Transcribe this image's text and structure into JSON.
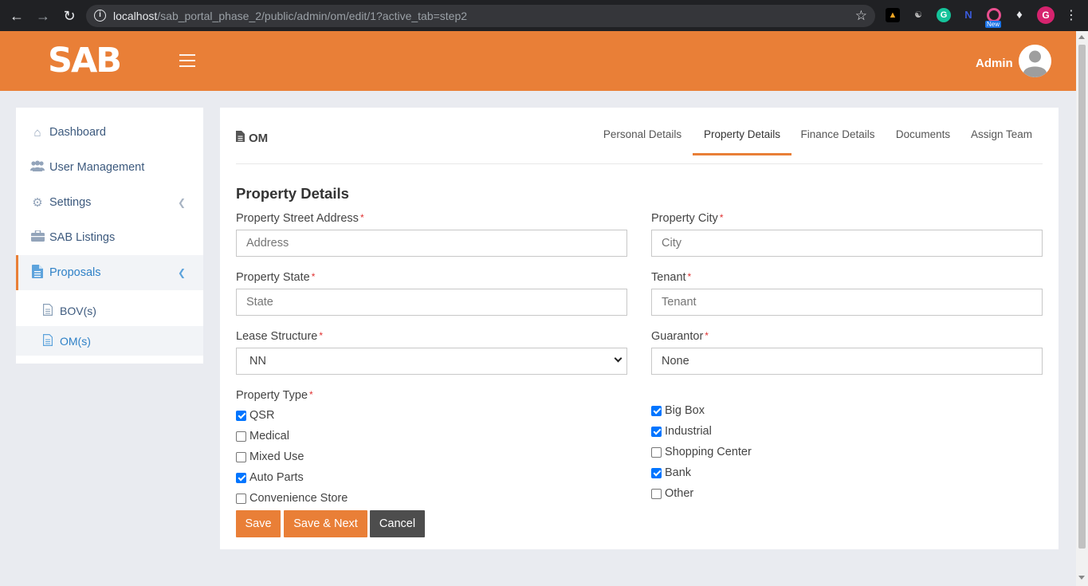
{
  "browser": {
    "url_host": "localhost",
    "url_path": "/sab_portal_phase_2/public/admin/om/edit/1?active_tab=step2",
    "ext_new_badge": "New",
    "profile_initial": "G"
  },
  "header": {
    "logo": "SAB",
    "admin_name": "Admin"
  },
  "sidebar": {
    "items": [
      {
        "label": "Dashboard"
      },
      {
        "label": "User Management"
      },
      {
        "label": "Settings"
      },
      {
        "label": "SAB Listings"
      },
      {
        "label": "Proposals"
      }
    ],
    "subitems": [
      {
        "label": "BOV(s)"
      },
      {
        "label": "OM(s)"
      }
    ]
  },
  "page": {
    "title": "OM",
    "tabs": [
      {
        "label": "Personal Details"
      },
      {
        "label": "Property Details"
      },
      {
        "label": "Finance Details"
      },
      {
        "label": "Documents"
      },
      {
        "label": "Assign Team"
      }
    ],
    "active_tab": "Property Details",
    "section_title": "Property Details"
  },
  "form": {
    "street": {
      "label": "Property Street Address",
      "placeholder": "Address"
    },
    "city": {
      "label": "Property City",
      "placeholder": "City"
    },
    "state": {
      "label": "Property State",
      "placeholder": "State"
    },
    "tenant": {
      "label": "Tenant",
      "placeholder": "Tenant"
    },
    "lease": {
      "label": "Lease Structure",
      "value": "NN"
    },
    "guarantor": {
      "label": "Guarantor",
      "value": "None"
    },
    "property_type": {
      "label": "Property Type",
      "options": [
        {
          "label": "QSR",
          "checked": true
        },
        {
          "label": "Medical",
          "checked": false
        },
        {
          "label": "Mixed Use",
          "checked": false
        },
        {
          "label": "Auto Parts",
          "checked": true
        },
        {
          "label": "Convenience Store",
          "checked": false
        },
        {
          "label": "Big Box",
          "checked": true
        },
        {
          "label": "Industrial",
          "checked": true
        },
        {
          "label": "Shopping Center",
          "checked": false
        },
        {
          "label": "Bank",
          "checked": true
        },
        {
          "label": "Other",
          "checked": false
        }
      ]
    },
    "required_mark": "*"
  },
  "buttons": {
    "save": "Save",
    "save_next": "Save & Next",
    "cancel": "Cancel"
  },
  "colors": {
    "brand_orange": "#e97f37",
    "link_blue": "#2f81c7",
    "checkbox_blue": "#0075ff"
  }
}
